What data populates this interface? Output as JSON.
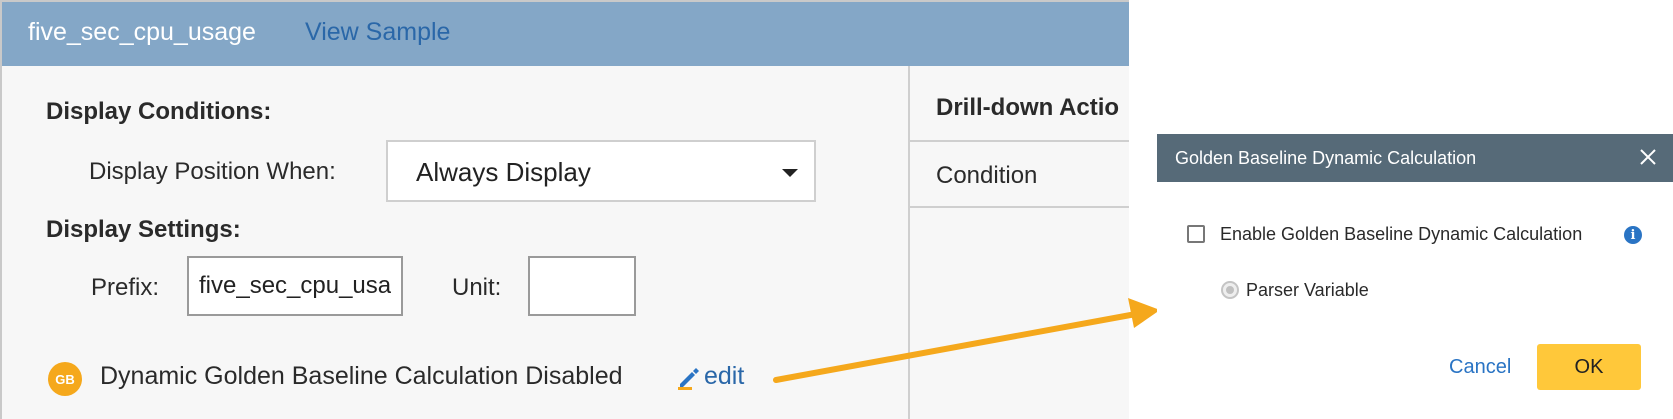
{
  "header": {
    "title": "five_sec_cpu_usage",
    "view_sample_link": "View Sample"
  },
  "display_conditions": {
    "section_label": "Display Conditions:",
    "position_label": "Display Position When:",
    "position_value": "Always Display"
  },
  "display_settings": {
    "section_label": "Display Settings:",
    "prefix_label": "Prefix:",
    "prefix_value": "five_sec_cpu_usage",
    "unit_label": "Unit:",
    "unit_value": ""
  },
  "golden_baseline": {
    "badge": "GB",
    "status_text": "Dynamic Golden Baseline Calculation Disabled",
    "edit_link": "edit",
    "icon": "pencil-icon"
  },
  "drilldown": {
    "title": "Drill-down Actio",
    "column_header": "Condition"
  },
  "dialog": {
    "title": "Golden Baseline Dynamic Calculation",
    "close_icon": "close-icon",
    "enable_checkbox_label": "Enable Golden Baseline Dynamic Calculation",
    "enable_checked": false,
    "info_icon": "info-icon",
    "parser_variable_label": "Parser Variable",
    "cancel_label": "Cancel",
    "ok_label": "OK"
  },
  "colors": {
    "header_bg": "#84a7c7",
    "link": "#2a67a8",
    "dialog_titlebar": "#566a78",
    "ok_button": "#ffc83a",
    "arrow": "#f5a81c",
    "gb_badge": "#f5a81c"
  }
}
